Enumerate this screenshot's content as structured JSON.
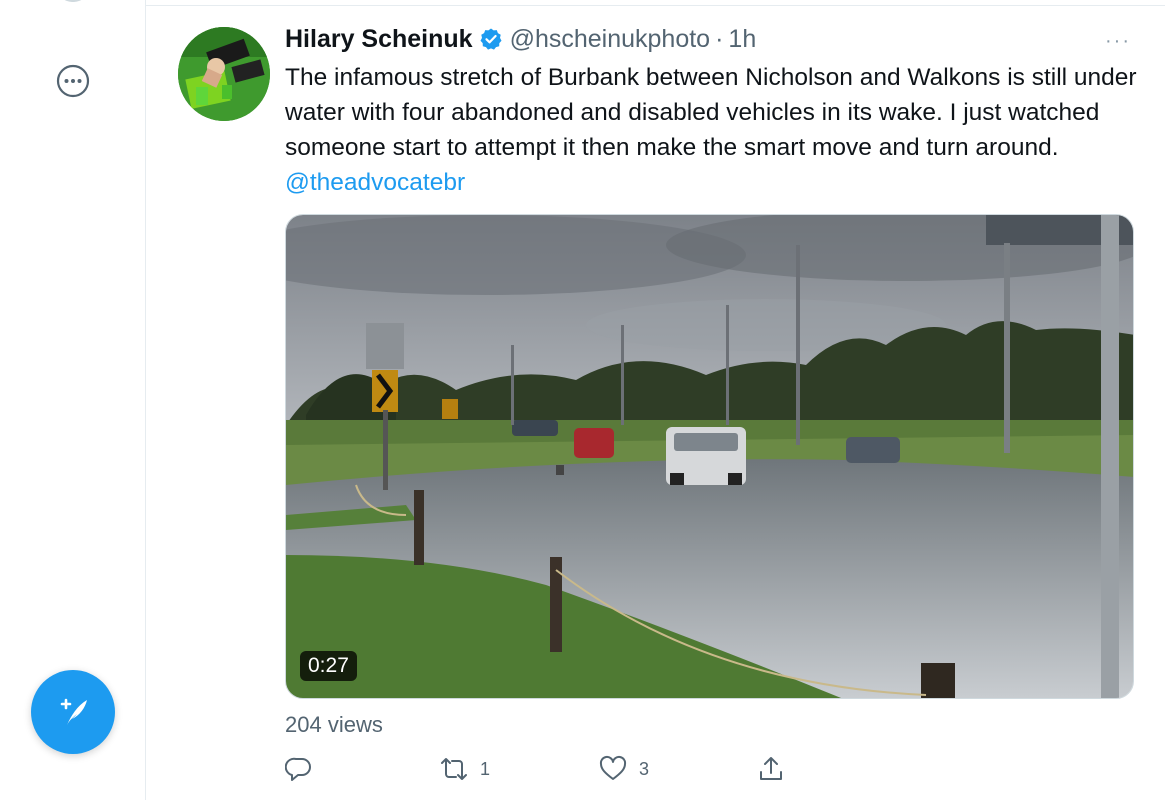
{
  "tweet": {
    "display_name": "Hilary Scheinuk",
    "handle": "@hscheinukphoto",
    "separator": "·",
    "timestamp": "1h",
    "more_label": "···",
    "text_before_mention": "The infamous stretch of Burbank between Nicholson and Walkons is still under water with four abandoned and disabled vehicles in its wake. I just watched someone start to attempt it then make the smart move and turn around.",
    "mention": "@theadvocatebr",
    "video_duration": "0:27",
    "views": "204 views",
    "retweet_count": "1",
    "like_count": "3"
  },
  "icons": {
    "left_more": "more-circle-icon",
    "compose": "compose-tweet-icon",
    "verified": "verified-badge-icon",
    "reply": "reply-icon",
    "retweet": "retweet-icon",
    "like": "heart-icon",
    "share": "share-icon"
  },
  "colors": {
    "accent": "#1d9bf0",
    "secondary_text": "#536471",
    "primary_text": "#0f1419"
  }
}
